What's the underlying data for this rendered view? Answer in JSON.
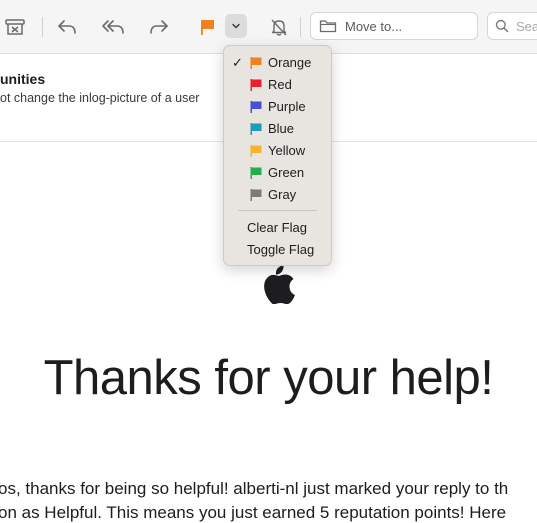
{
  "toolbar": {
    "move_placeholder": "Move to...",
    "search_placeholder": "Search",
    "search_visible": "Sea",
    "flag_color": "#f0821e"
  },
  "message": {
    "subject": "unities",
    "preview": "ot change the inlog-picture of a user"
  },
  "body": {
    "headline": "Thanks for your help!",
    "line1": "os, thanks for being so helpful! alberti-nl just marked your reply to th",
    "line2": "on as Helpful. This means you just earned 5 reputation points! Here"
  },
  "flag_menu": {
    "selected": "Orange",
    "items": [
      {
        "label": "Orange",
        "color": "#f0821e",
        "checked": true
      },
      {
        "label": "Red",
        "color": "#e8202f"
      },
      {
        "label": "Purple",
        "color": "#4d4ed6"
      },
      {
        "label": "Blue",
        "color": "#1e9bb9"
      },
      {
        "label": "Yellow",
        "color": "#f7b32b"
      },
      {
        "label": "Green",
        "color": "#23b04b"
      },
      {
        "label": "Gray",
        "color": "#7a7a7a"
      }
    ],
    "check_glyph": "✓",
    "actions": {
      "clear": "Clear Flag",
      "toggle": "Toggle Flag"
    }
  }
}
